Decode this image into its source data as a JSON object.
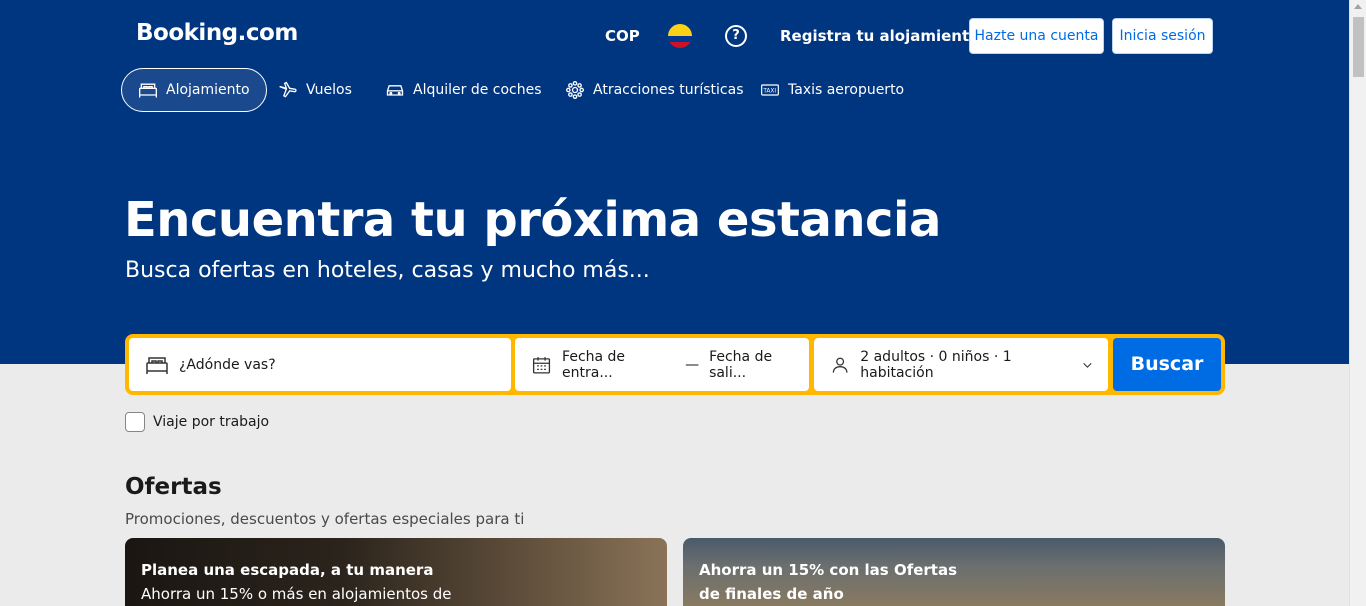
{
  "header": {
    "logo": "Booking.com",
    "currency": "COP",
    "help": "?",
    "register_property": "Registra tu alojamiento",
    "create_account": "Hazte una cuenta",
    "sign_in": "Inicia sesión"
  },
  "nav": [
    {
      "label": "Alojamiento",
      "icon": "bed-icon",
      "active": true
    },
    {
      "label": "Vuelos",
      "icon": "plane-icon"
    },
    {
      "label": "Alquiler de coches",
      "icon": "car-icon"
    },
    {
      "label": "Atracciones turísticas",
      "icon": "attractions-icon"
    },
    {
      "label": "Taxis aeropuerto",
      "icon": "taxi-icon"
    }
  ],
  "hero": {
    "title": "Encuentra tu próxima estancia",
    "subtitle": "Busca ofertas en hoteles, casas y mucho más..."
  },
  "search": {
    "destination_placeholder": "¿Adónde vas?",
    "checkin": "Fecha de entra...",
    "separator": "—",
    "checkout": "Fecha de sali...",
    "guests": "2 adultos · 0 niños · 1 habitación",
    "button": "Buscar",
    "business_trip": "Viaje por trabajo"
  },
  "offers": {
    "title": "Ofertas",
    "subtitle": "Promociones, descuentos y ofertas especiales para ti",
    "cards": [
      {
        "title": "Planea una escapada, a tu manera",
        "text": "Ahorra un 15% o más en alojamientos de"
      },
      {
        "title": "Ahorra un 15% con las Ofertas de finales de año",
        "text": ""
      }
    ]
  },
  "colors": {
    "brand": "#003580",
    "accent": "#006ce4",
    "search_border": "#ffb700"
  }
}
